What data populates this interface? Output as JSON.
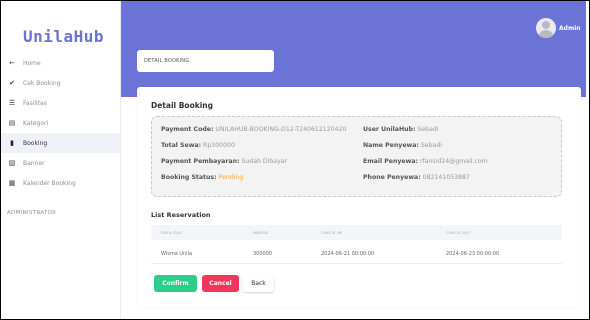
{
  "app": {
    "brand": "UnilaHub"
  },
  "sidebar": {
    "items": [
      {
        "label": "Home",
        "icon": "arrow-left-icon",
        "glyph": "←",
        "active": false
      },
      {
        "label": "Cek Booking",
        "icon": "check-icon",
        "glyph": "✔",
        "active": false
      },
      {
        "label": "Fasilitas",
        "icon": "list-icon",
        "glyph": "☰",
        "active": false
      },
      {
        "label": "Kategori",
        "icon": "table-icon",
        "glyph": "▤",
        "active": false
      },
      {
        "label": "Booking",
        "icon": "book-icon",
        "glyph": "▮",
        "active": true
      },
      {
        "label": "Banner",
        "icon": "image-icon",
        "glyph": "▨",
        "active": false
      },
      {
        "label": "Kalender Booking",
        "icon": "calendar-icon",
        "glyph": "▦",
        "active": false
      }
    ],
    "section_label": "ADMINISTRATOR"
  },
  "header": {
    "user_name": "Admin"
  },
  "breadcrumb": {
    "title": "DETAIL BOOKING"
  },
  "detail": {
    "title": "Detail Booking",
    "payment_code": {
      "label": "Payment Code:",
      "value": "UNILAHUB-BOOKING-D12-T240612120420"
    },
    "total_sewa": {
      "label": "Total Sewa:",
      "value": "Rp300000"
    },
    "payment_status": {
      "label": "Payment Pembayaran:",
      "value": "Sudah Dibayar"
    },
    "booking_status": {
      "label": "Booking Status:",
      "value": "Pending",
      "color": "#f0a63c"
    },
    "user": {
      "label": "User UnilaHub:",
      "value": "Sebadi"
    },
    "name": {
      "label": "Name Penyewa:",
      "value": "Sebadi"
    },
    "email": {
      "label": "Email Penyewa:",
      "value": "rfansid24@gmail.com"
    },
    "phone": {
      "label": "Phone Penyewa:",
      "value": "082141053887"
    }
  },
  "reservations": {
    "title": "List Reservation",
    "columns": [
      "FASILITAS",
      "HARGA",
      "CHECK IN",
      "CHECK OUT"
    ],
    "rows": [
      [
        "Wisma Unila",
        "300000",
        "2024-06-21 00:00:00",
        "2024-06-23 00:00:00"
      ]
    ]
  },
  "actions": {
    "confirm_label": "Confirm",
    "cancel_label": "Cancel",
    "back_label": "Back"
  },
  "colors": {
    "primary": "#6b74d6",
    "confirm": "#2dce89",
    "cancel": "#f5365c"
  }
}
